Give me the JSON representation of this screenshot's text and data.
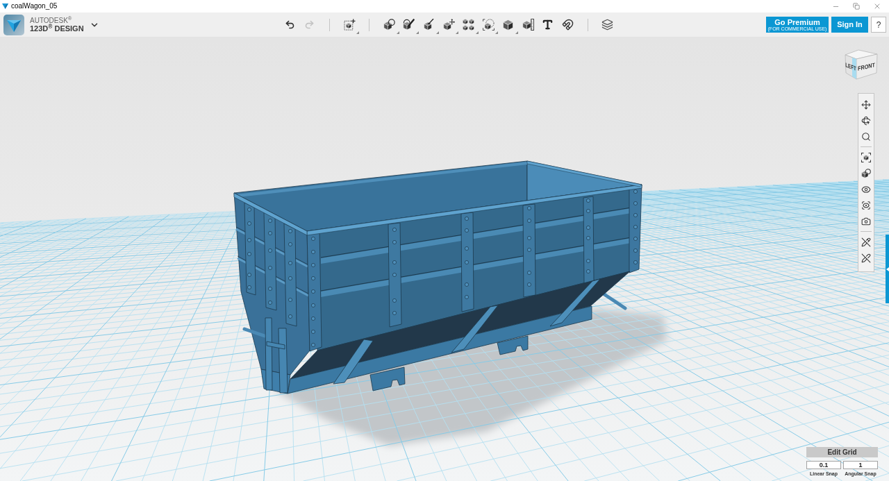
{
  "window": {
    "title": "coalWagon_05"
  },
  "header": {
    "brand": "AUTODESK$^{®}$",
    "product": "123D$^{®}$ DESIGN",
    "undo": {
      "disabled": false
    },
    "redo": {
      "disabled": true
    },
    "premium_button": {
      "label": "Go Premium",
      "sublabel": "(FOR COMMERCIAL USE)"
    },
    "sign_in_button": "Sign In",
    "help_button": "?"
  },
  "view_cube": {
    "left": "LEFT",
    "front": "FRONT"
  },
  "grid_panel": {
    "title": "Edit Grid",
    "fields": [
      {
        "value": "0.1",
        "label": "Linear Snap"
      },
      {
        "value": "1",
        "label": "Angular Snap"
      }
    ]
  }
}
